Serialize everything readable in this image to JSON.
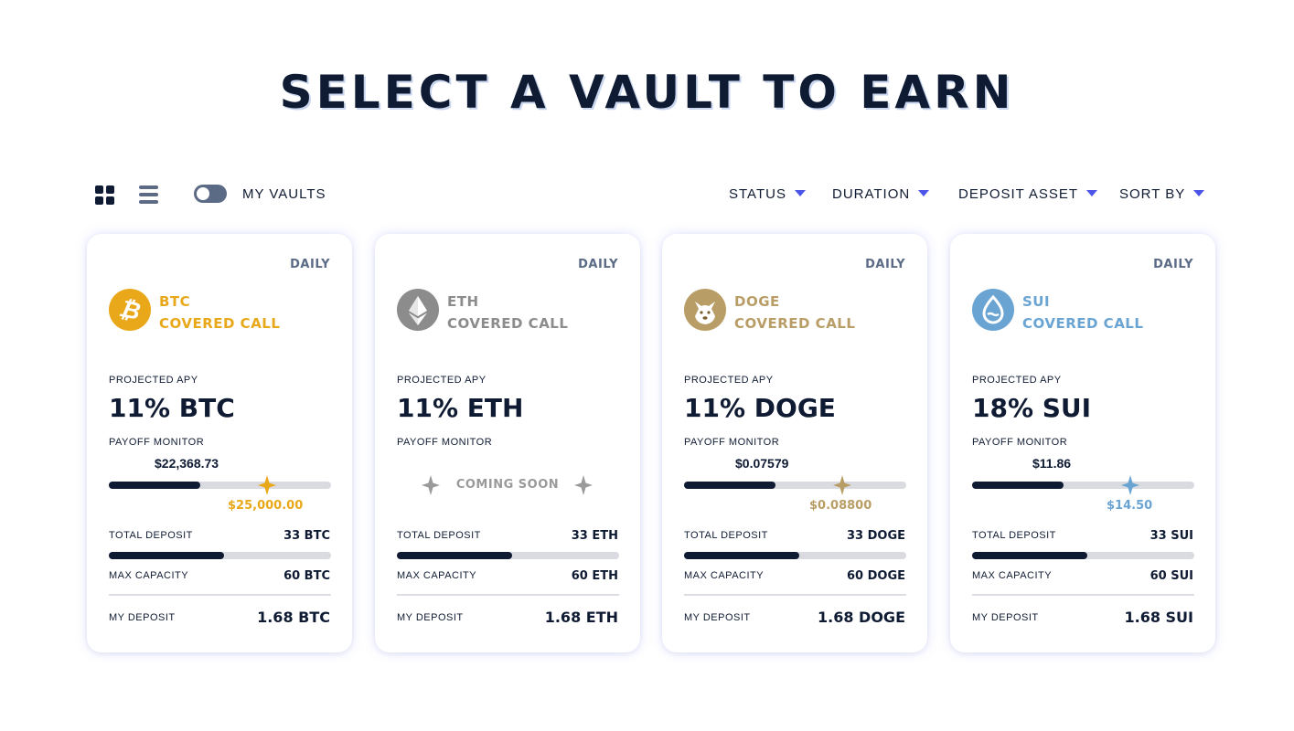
{
  "page": {
    "title": "SELECT A VAULT TO EARN"
  },
  "toolbar": {
    "my_vaults_label": "MY VAULTS",
    "filters": {
      "status": "STATUS",
      "duration": "DURATION",
      "deposit_asset": "DEPOSIT ASSET",
      "sort_by": "SORT BY"
    }
  },
  "labels": {
    "projected_apy": "PROJECTED APY",
    "payoff_monitor": "PAYOFF MONITOR",
    "total_deposit": "TOTAL DEPOSIT",
    "max_capacity": "MAX CAPACITY",
    "my_deposit": "MY DEPOSIT"
  },
  "colors": {
    "navy": "#0f1b33",
    "accent": "#4b54e6",
    "btc": "#e9a81a",
    "eth": "#8c8c8c",
    "doge": "#b99d66",
    "sui": "#6aa4d3"
  },
  "vaults": [
    {
      "duration": "DAILY",
      "icon": "bitcoin-icon",
      "asset": "BTC",
      "strategy": "COVERED CALL",
      "apy": "11% BTC",
      "current_price": "$22,368.73",
      "strike_price": "$25,000.00",
      "price_progress": 0.41,
      "strike_position": 0.71,
      "coming_soon": "",
      "total_deposit": "33 BTC",
      "max_capacity": "60 BTC",
      "deposit_progress": 0.52,
      "my_deposit": "1.68 BTC"
    },
    {
      "duration": "DAILY",
      "icon": "ethereum-icon",
      "asset": "ETH",
      "strategy": "COVERED CALL",
      "apy": "11% ETH",
      "current_price": "",
      "strike_price": "",
      "coming_soon": "COMING SOON",
      "total_deposit": "33 ETH",
      "max_capacity": "60 ETH",
      "deposit_progress": 0.52,
      "my_deposit": "1.68 ETH"
    },
    {
      "duration": "DAILY",
      "icon": "doge-icon",
      "asset": "DOGE",
      "strategy": "COVERED CALL",
      "apy": "11% DOGE",
      "current_price": "$0.07579",
      "strike_price": "$0.08800",
      "price_progress": 0.41,
      "strike_position": 0.71,
      "coming_soon": "",
      "total_deposit": "33 DOGE",
      "max_capacity": "60 DOGE",
      "deposit_progress": 0.52,
      "my_deposit": "1.68 DOGE"
    },
    {
      "duration": "DAILY",
      "icon": "sui-icon",
      "asset": "SUI",
      "strategy": "COVERED CALL",
      "apy": "18% SUI",
      "current_price": "$11.86",
      "strike_price": "$14.50",
      "price_progress": 0.41,
      "strike_position": 0.71,
      "coming_soon": "",
      "total_deposit": "33 SUI",
      "max_capacity": "60 SUI",
      "deposit_progress": 0.52,
      "my_deposit": "1.68 SUI"
    }
  ]
}
